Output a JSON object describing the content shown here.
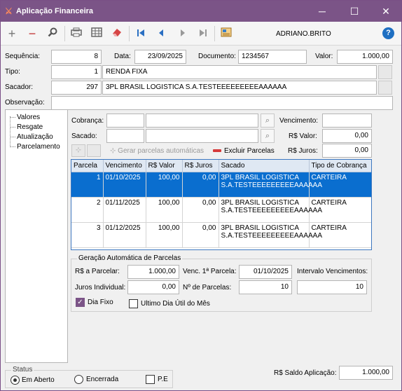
{
  "window": {
    "title": "Aplicação Financeira",
    "min": "─",
    "max": "☐",
    "close": "✕"
  },
  "toolbar": {
    "user": "ADRIANO.BRITO",
    "help": "?"
  },
  "form": {
    "sequencia_label": "Sequência:",
    "sequencia_value": "8",
    "data_label": "Data:",
    "data_value": "23/09/2025",
    "documento_label": "Documento:",
    "documento_value": "1234567",
    "valor_label": "Valor:",
    "valor_value": "1.000,00",
    "tipo_label": "Tipo:",
    "tipo_code": "1",
    "tipo_desc": "RENDA FIXA",
    "sacador_label": "Sacador:",
    "sacador_code": "297",
    "sacador_desc": "3PL BRASIL LOGISTICA S.A.TESTEEEEEEEEEAAAAAA",
    "observacao_label": "Observação:",
    "observacao_value": ""
  },
  "tree": {
    "items": [
      "Valores",
      "Resgate",
      "Atualização",
      "Parcelamento"
    ]
  },
  "parcelamento": {
    "cobranca_label": "Cobrança:",
    "sacado_label": "Sacado:",
    "vencimento_label": "Vencimento:",
    "rs_valor_label": "R$ Valor:",
    "rs_valor_value": "0,00",
    "rs_juros_label": "R$ Juros:",
    "rs_juros_value": "0,00",
    "gerar_label": "Gerar parcelas automáticas",
    "excluir_label": "Excluir Parcelas"
  },
  "grid": {
    "columns": [
      "Parcela",
      "Vencimento",
      "R$ Valor",
      "R$ Juros",
      "Sacado",
      "Tipo de Cobrança"
    ],
    "rows": [
      {
        "parcela": "1",
        "vencimento": "01/10/2025",
        "valor": "100,00",
        "juros": "0,00",
        "sacado": "3PL BRASIL LOGISTICA S.A.TESTEEEEEEEEEAAAAAA",
        "tipo": "CARTEIRA"
      },
      {
        "parcela": "2",
        "vencimento": "01/11/2025",
        "valor": "100,00",
        "juros": "0,00",
        "sacado": "3PL BRASIL LOGISTICA S.A.TESTEEEEEEEEEAAAAAA",
        "tipo": "CARTEIRA"
      },
      {
        "parcela": "3",
        "vencimento": "01/12/2025",
        "valor": "100,00",
        "juros": "0,00",
        "sacado": "3PL BRASIL LOGISTICA S.A.TESTEEEEEEEEEAAAAAA",
        "tipo": "CARTEIRA"
      }
    ]
  },
  "geracao": {
    "title": "Geração Automática de Parcelas",
    "rs_parcelar_label": "R$ a Parcelar:",
    "rs_parcelar_value": "1.000,00",
    "venc_label": "Venc. 1ª Parcela:",
    "venc_value": "01/10/2025",
    "intervalo_label": "Intervalo Vencimentos:",
    "intervalo_value": "10",
    "juros_label": "Juros Individual:",
    "juros_value": "0,00",
    "nparcelas_label": "Nº de Parcelas:",
    "nparcelas_value": "10",
    "dia_fixo_label": "Dia Fixo",
    "ultimo_dia_label": "Ultimo Dia Útil do Mês"
  },
  "status": {
    "title": "Status",
    "em_aberto": "Em Aberto",
    "encerrada": "Encerrada",
    "pe": "P.E",
    "saldo_label": "R$ Saldo Aplicação:",
    "saldo_value": "1.000,00"
  },
  "colors": {
    "titlebar": "#7b5487",
    "selection": "#0a6ecf",
    "accent": "#1e6fc2"
  }
}
